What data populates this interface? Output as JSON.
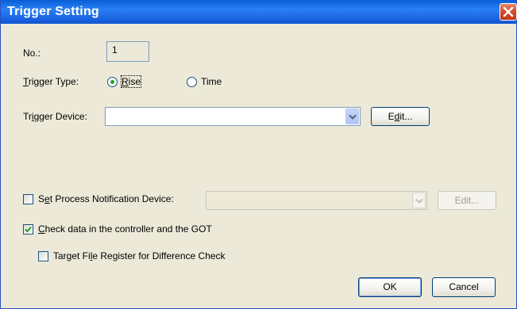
{
  "window": {
    "title": "Trigger Setting"
  },
  "fields": {
    "no_label": "No.:",
    "no_value": "1",
    "trigger_type_label": "Trigger Type:",
    "rise_label": "Rise",
    "time_label": "Time",
    "selected_trigger_type": "Rise",
    "trigger_device_label": "Trigger Device:",
    "trigger_device_value": "",
    "edit_label": "Edit...",
    "set_process_label": "Set Process Notification Device:",
    "set_process_checked": false,
    "process_device_value": "",
    "process_edit_label": "Edit...",
    "check_data_label": "Check data in the controller and the GOT",
    "check_data_checked": true,
    "target_file_label": "Target File Register for Difference Check",
    "target_file_checked": false
  },
  "buttons": {
    "ok": "OK",
    "cancel": "Cancel"
  },
  "colors": {
    "titlebar": "#0a5fd8",
    "dialog_bg": "#ece9d8",
    "radio_dot": "#21a121",
    "check_mark": "#21a121",
    "close_button": "#d24a2a"
  }
}
